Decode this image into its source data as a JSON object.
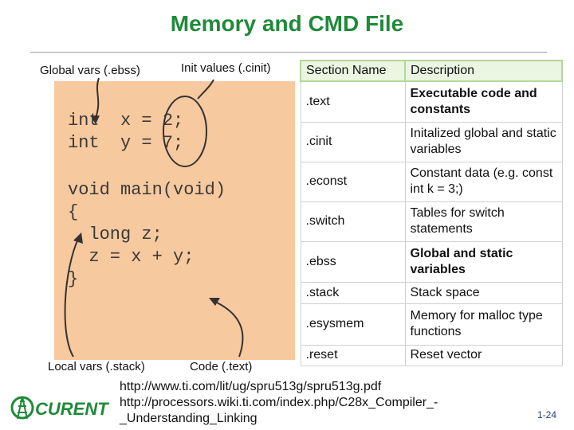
{
  "slide": {
    "title": "Memory and CMD File",
    "page_number": "1-24"
  },
  "labels": {
    "global_vars": "Global vars (.ebss)",
    "init_values": "Init values (.cinit)",
    "local_vars": "Local vars (.stack)",
    "code_text": "Code (.text)"
  },
  "code_lines": [
    "int  x = 2;",
    "int  y = 7;",
    "",
    "void main(void)",
    "{",
    "  long z;",
    "  z = x + y;",
    "}"
  ],
  "table": {
    "headers": [
      "Section Name",
      "Description"
    ],
    "rows": [
      {
        "name": ".text",
        "description": "Executable code and constants",
        "bold": true
      },
      {
        "name": ".cinit",
        "description": "Initalized global and static variables",
        "bold": false
      },
      {
        "name": ".econst",
        "description": "Constant data (e.g. const int k = 3;)",
        "bold": false
      },
      {
        "name": ".switch",
        "description": "Tables for switch statements",
        "bold": false
      },
      {
        "name": ".ebss",
        "description": "Global and static variables",
        "bold": true
      },
      {
        "name": ".stack",
        "description": "Stack space",
        "bold": false
      },
      {
        "name": ".esysmem",
        "description": "Memory for malloc type functions",
        "bold": false
      },
      {
        "name": ".reset",
        "description": "Reset vector",
        "bold": false
      }
    ]
  },
  "links": [
    "http://www.ti.com/lit/ug/spru513g/spru513g.pdf",
    "http://processors.wiki.ti.com/index.php/C28x_Compiler_-",
    "_Understanding_Linking"
  ],
  "logo": {
    "text": "CURENT",
    "icon": "tower-icon"
  },
  "colors": {
    "title": "#1f8a3a",
    "code_box": "#f7c99f",
    "header_fill": "#eaf5e2",
    "logo": "#1f8a3a"
  }
}
